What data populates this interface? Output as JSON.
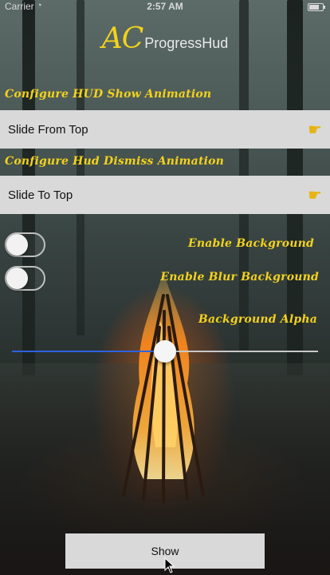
{
  "status_bar": {
    "carrier": "Carrier",
    "time": "2:57 AM"
  },
  "header": {
    "logo_ac": "AC",
    "logo_rest": "ProgressHud"
  },
  "show_animation": {
    "label": "Configure HUD Show Animation",
    "value": "Slide From Top",
    "icon": "pointing-hand-icon"
  },
  "dismiss_animation": {
    "label": "Configure Hud Dismiss Animation",
    "value": "Slide To Top",
    "icon": "pointing-hand-icon"
  },
  "toggles": [
    {
      "label": "Enable Background",
      "on": false
    },
    {
      "label": "Enable Blur Background",
      "on": false
    }
  ],
  "background_alpha": {
    "label": "Background Alpha",
    "value": 0.5
  },
  "show_button": {
    "label": "Show"
  },
  "colors": {
    "accent_yellow": "#f3d21c",
    "slider_fill": "#2f62e0",
    "control_bg": "#d9d9d9"
  }
}
